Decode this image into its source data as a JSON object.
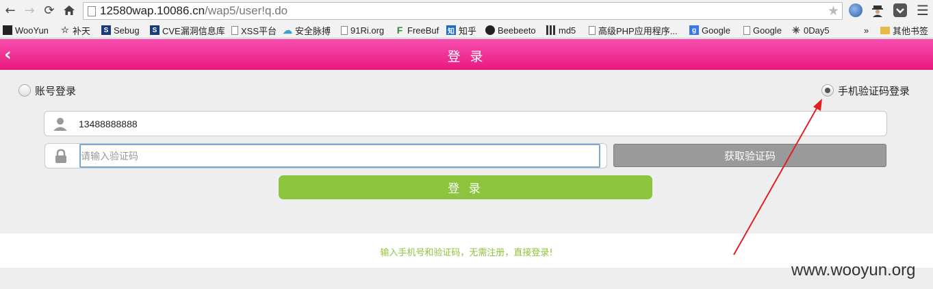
{
  "browser": {
    "url_host": "12580wap.10086.cn",
    "url_path": "/wap5/user!q.do",
    "icons": [
      "back-arrow-icon",
      "forward-arrow-icon",
      "reload-icon",
      "home-icon",
      "star-icon",
      "globe-icon",
      "spy-icon",
      "pocket-icon",
      "menu-icon"
    ]
  },
  "bookmarks": {
    "items": [
      "WooYun",
      "补天",
      "Sebug",
      "CVE漏洞信息库",
      "XSS平台",
      "安全脉搏",
      "91Ri.org",
      "FreeBuf",
      "知乎",
      "Beebeeto",
      "md5",
      "高级PHP应用程序...",
      "Google",
      "Google",
      "0Day5"
    ],
    "overflow": "»",
    "other": "其他书签"
  },
  "app": {
    "title": "登 录",
    "radio_account": "账号登录",
    "radio_sms": "手机验证码登录",
    "phone_value": "13488888888",
    "code_placeholder": "请输入验证码",
    "get_code_label": "获取验证码",
    "login_label": "登 录",
    "tip": "输入手机号和验证码，无需注册，直接登录!",
    "accent_color": "#e8197f",
    "button_color": "#8cc53d"
  },
  "watermark": "www.wooyun.org"
}
